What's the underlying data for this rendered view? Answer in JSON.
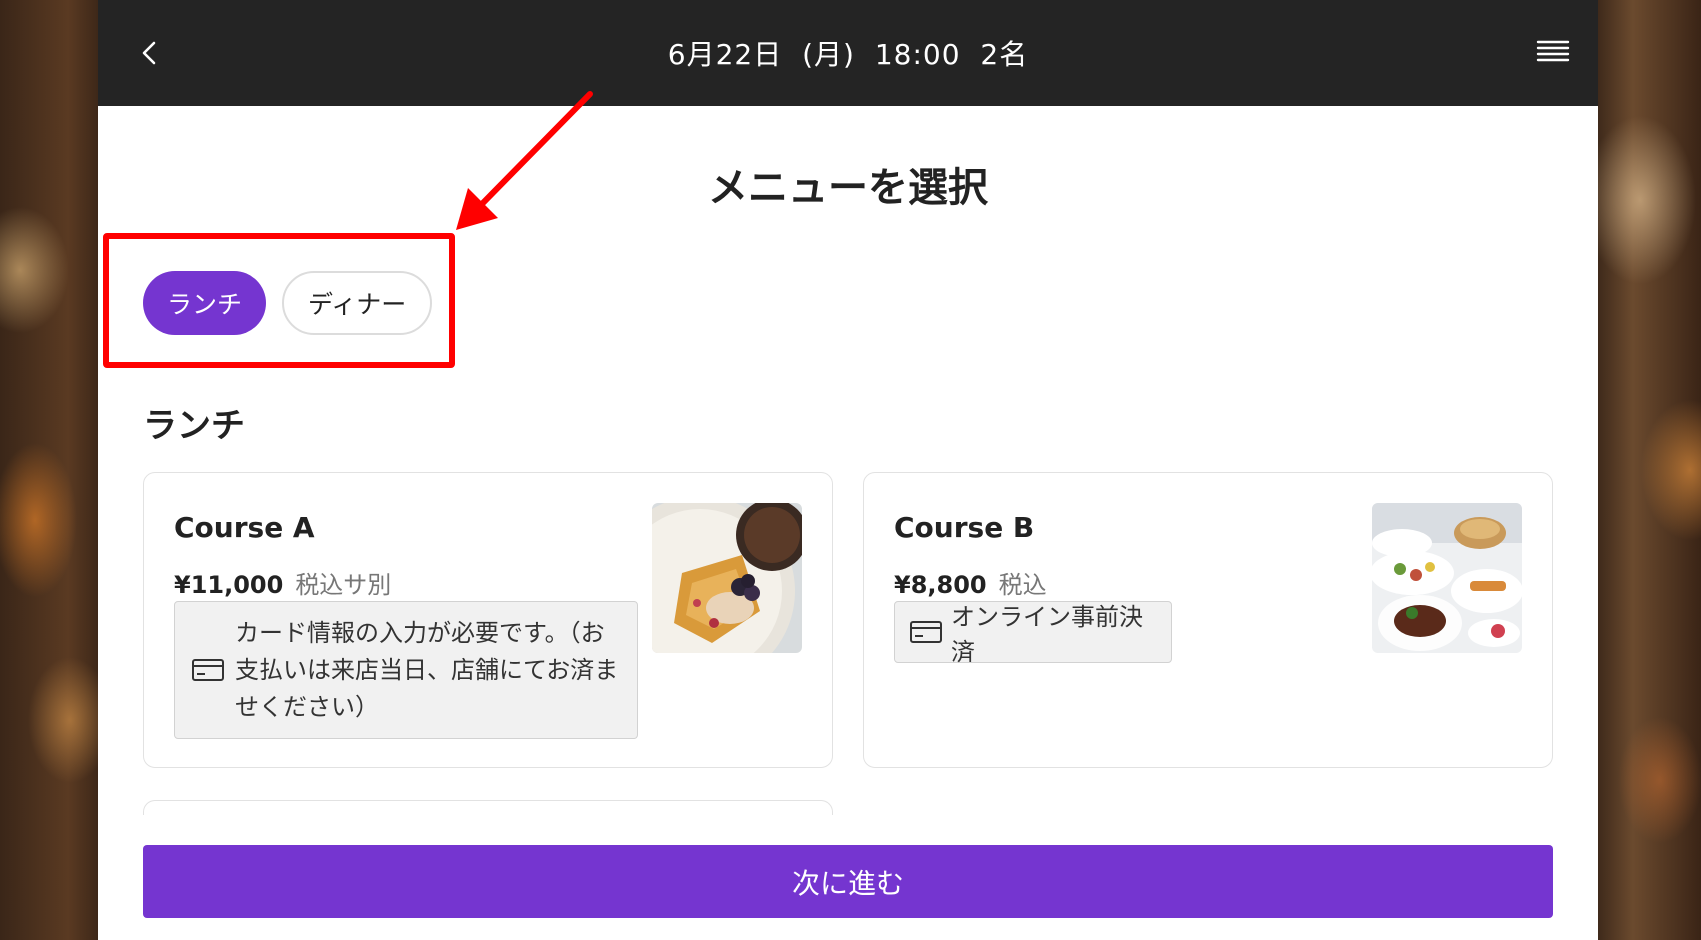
{
  "header": {
    "title": "6月22日 (月)  18:00  2名",
    "back_icon": "chevron-left-icon",
    "menu_icon": "hamburger-menu-icon"
  },
  "page_title": "メニューを選択",
  "tabs": [
    {
      "label": "ランチ",
      "active": true
    },
    {
      "label": "ディナー",
      "active": false
    }
  ],
  "section": {
    "title": "ランチ"
  },
  "courses": [
    {
      "name": "Course A",
      "price": "¥11,000",
      "tax_note": "税込サ別",
      "payment_note": "カード情報の入力が必要です。（お支払いは来店当日、店舗にてお済ませください）",
      "payment_icon": "credit-card-icon",
      "image": "waffle-plate"
    },
    {
      "name": "Course B",
      "price": "¥8,800",
      "tax_note": "税込",
      "payment_note": "オンライン事前決済",
      "payment_icon": "credit-card-icon",
      "image": "dishes-spread"
    }
  ],
  "next_button": {
    "label": "次に進む"
  },
  "colors": {
    "accent": "#7535d0",
    "header_bg": "#242424",
    "annotation_red": "#ff0000"
  }
}
